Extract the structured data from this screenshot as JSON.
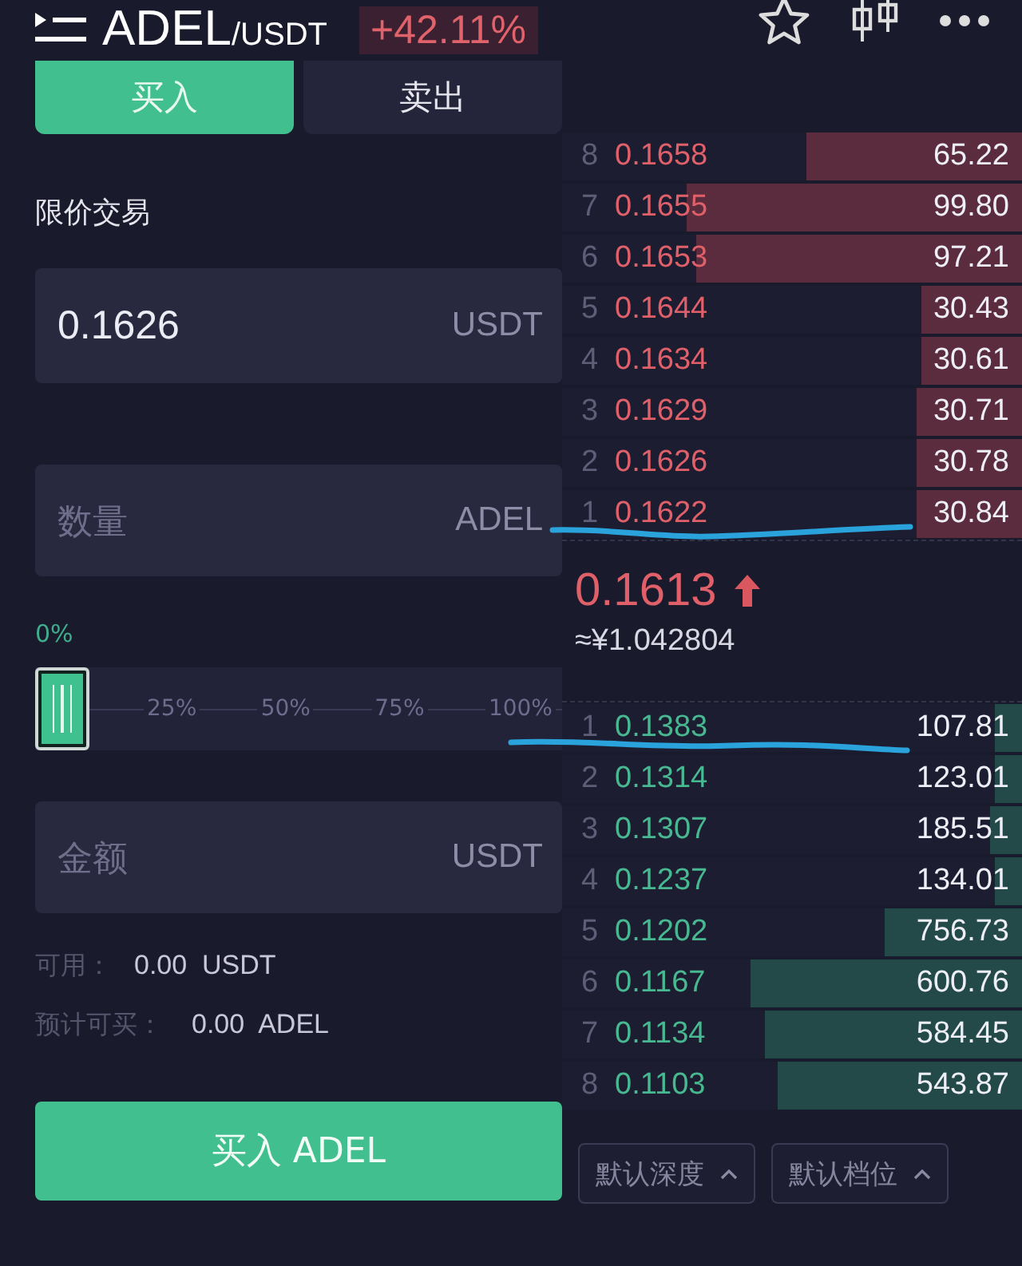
{
  "header": {
    "base": "ADEL",
    "quote": "/USDT",
    "change": "+42.11%"
  },
  "tabs": [
    {
      "label": "买入",
      "selected": true
    },
    {
      "label": "卖出",
      "selected": false
    }
  ],
  "order_type": "限价交易",
  "price_field": {
    "value": "0.1626",
    "unit": "USDT"
  },
  "amount_field": {
    "placeholder": "数量",
    "unit": "ADEL"
  },
  "slider": {
    "reading": "0%",
    "ticks": [
      "25%",
      "50%",
      "75%",
      "100%"
    ]
  },
  "total_field": {
    "placeholder": "金额",
    "unit": "USDT"
  },
  "balances": [
    {
      "label": "可用：",
      "value": "0.00  USDT"
    },
    {
      "label": "预计可买：",
      "value": "0.00  ADEL"
    }
  ],
  "submit_button": "买入 ADEL",
  "asks": [
    {
      "index": "8",
      "price": "0.1658",
      "amount": "65.22",
      "level": 0.47
    },
    {
      "index": "7",
      "price": "0.1655",
      "amount": "99.80",
      "level": 0.73
    },
    {
      "index": "6",
      "price": "0.1653",
      "amount": "97.21",
      "level": 0.71
    },
    {
      "index": "5",
      "price": "0.1644",
      "amount": "30.43",
      "level": 0.22
    },
    {
      "index": "4",
      "price": "0.1634",
      "amount": "30.61",
      "level": 0.22
    },
    {
      "index": "3",
      "price": "0.1629",
      "amount": "30.71",
      "level": 0.23
    },
    {
      "index": "2",
      "price": "0.1626",
      "amount": "30.78",
      "level": 0.23
    },
    {
      "index": "1",
      "price": "0.1622",
      "amount": "30.84",
      "level": 0.23
    }
  ],
  "last_price": {
    "price": "0.1613",
    "cny": "≈¥1.042804"
  },
  "bids": [
    {
      "index": "1",
      "price": "0.1383",
      "amount": "107.81",
      "level": 0.06
    },
    {
      "index": "2",
      "price": "0.1314",
      "amount": "123.01",
      "level": 0.06
    },
    {
      "index": "3",
      "price": "0.1307",
      "amount": "185.51",
      "level": 0.07
    },
    {
      "index": "4",
      "price": "0.1237",
      "amount": "134.01",
      "level": 0.06
    },
    {
      "index": "5",
      "price": "0.1202",
      "amount": "756.73",
      "level": 0.3
    },
    {
      "index": "6",
      "price": "0.1167",
      "amount": "600.76",
      "level": 0.59
    },
    {
      "index": "7",
      "price": "0.1134",
      "amount": "584.45",
      "level": 0.56
    },
    {
      "index": "8",
      "price": "0.1103",
      "amount": "543.87",
      "level": 0.53
    }
  ],
  "depth_buttons": [
    "默认深度",
    "默认档位"
  ]
}
